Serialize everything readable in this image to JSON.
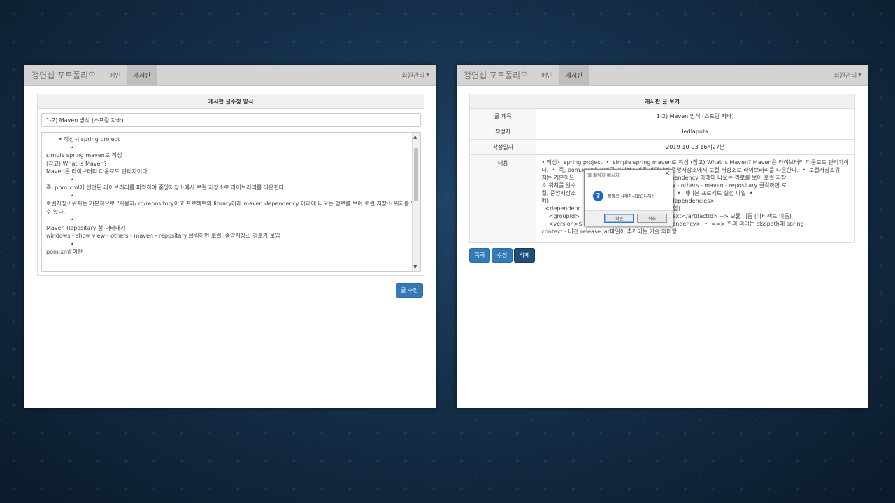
{
  "left_page": {
    "brand": "정연섭 포트폴리오",
    "nav": [
      "메인",
      "게시판"
    ],
    "nav_right": "회원관리",
    "form_title": "게시판 글수정 양식",
    "title_value": "1-2) Maven 방식 (스프링 자바)",
    "content_lines": [
      "• 작성시 spring project",
      "•",
      "simple spring maven로 작성",
      "(참고) What is Maven?",
      "Maven은 라이브러리 다운로드 관리자이다.",
      "•",
      "즉, pom.xml에 선언된 라이브러리를 파악하여 중앙저장소에서 로컬 저장소로 라이브러리를 다운한다.",
      "•",
      "로컬저장소위치는 기본적으로 \"사용자/.m/repository이고 프로젝트의 library아래 maven dependency 아래에 나오는 경로를 보아 로컬 저장소 위치를 알",
      "수 있다.",
      "•",
      "Maven Repositary 창 내타내기",
      "windows - show view - others - maven - repositary 클릭하면 로컬, 중앙저장소 경로가 보임",
      "•",
      "pom.xml 이란"
    ],
    "submit_label": "글 수정"
  },
  "right_page": {
    "brand": "정연섭 포트폴리오",
    "nav": [
      "메인",
      "게시판"
    ],
    "nav_right": "회원관리",
    "table_title": "게시판 글 보기",
    "rows": [
      {
        "label": "글 제목",
        "value": "1-2) Maven 방식 (스프링 자바)"
      },
      {
        "label": "작성자",
        "value": "ledlaputa"
      },
      {
        "label": "작성일자",
        "value": "2019-10-03 16시27분"
      }
    ],
    "content_label": "내용",
    "content_lines": [
      "• 작성시 spring project  •  simple spring maven로 작성 (참고) What is Maven? Maven은 라이브러리 다운로드 관리자이",
      "다.  •  즉, pom.xml에 선언된 라이브러리를 파악하여 중앙저장소에서 로컬 저장소로 라이브러리를 다운한다.  •  로컬저장소위",
      "치는 기본적으               트의 library아래 maven dependency 아래에 나오는 경로를 보아 로컬 저장",
      "소 위치를 알수               내기  windows - show view - others - maven - repositary 클릭하면 로",
      "컬, 중앙저장소               om(Project Object Model)  •  메이븐 프로젝트 설정 파일  •",
      "예)                                                                  <dependencies>",
      "  <dependenc               저장소에서 라이브러리 다운함)",
      "    <groupId>               <artifactId>spring-conrext</artifactId> --> 모듈 이름 (아티펙트 이름)",
      "    <version>$               rsion> --> 버전   </dependency>  •  ==> 위의 의미는 clsspath에 spring-",
      "context - 버전.release.jar파일이 추가되는 거슬 의미함."
    ],
    "buttons": [
      "목록",
      "수정",
      "삭제"
    ]
  },
  "dialog": {
    "title": "웹 페이지 메시지",
    "message": "정말로 삭제하시겠습니까?",
    "ok": "확인",
    "cancel": "취소"
  },
  "colors": {
    "primary": "#337ab7",
    "navbar": "#d4d4d4",
    "background": "#152f4a"
  }
}
